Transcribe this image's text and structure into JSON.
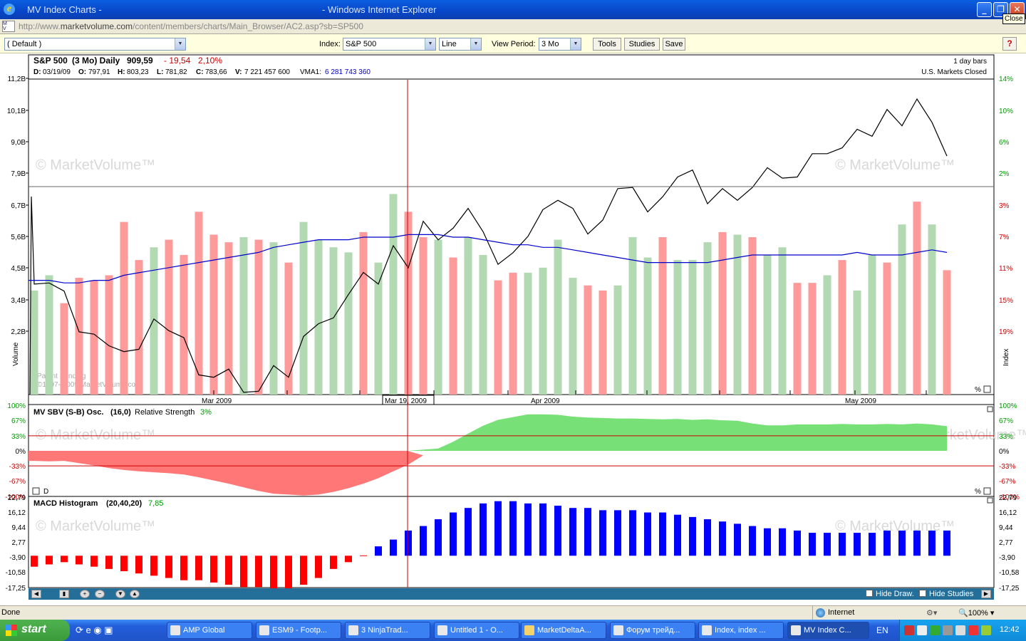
{
  "window": {
    "title_left": "MV Index Charts -",
    "title_right": "- Windows Internet Explorer",
    "tooltip": "Close"
  },
  "address": {
    "url_gray": "http://www.",
    "url_dark": "marketvolume.com",
    "url_rest": "/content/members/charts/Main_Browser/AC2.asp?sb=SP500"
  },
  "toolbar": {
    "template": "( Default )",
    "index_label": "Index:",
    "index_value": "S&P 500",
    "chart_type": "Line",
    "period_label": "View Period:",
    "period_value": "3 Mo",
    "tools": "Tools",
    "studies": "Studies",
    "save": "Save",
    "help": "?"
  },
  "header": {
    "name": "S&P 500",
    "period": "(3 Mo) Daily",
    "last": "909,59",
    "change": "- 19,54",
    "pct": "2,10%",
    "d_lbl": "D:",
    "d": "03/19/09",
    "o_lbl": "O:",
    "o": "797,91",
    "h_lbl": "H:",
    "h": "803,23",
    "l_lbl": "L:",
    "l": "781,82",
    "c_lbl": "C:",
    "c": "783,66",
    "v_lbl": "V:",
    "v": "7 221 457 600",
    "vma_lbl": "VMA1:",
    "vma": "6 281 743 360",
    "bars": "1 day bars",
    "market": "U.S. Markets Closed"
  },
  "panels": {
    "watermark": "© MarketVolume™",
    "patent": "Patent Pending",
    "copyright": "©1997- 2009 MarketVolume.com",
    "volume_axis": "Volume",
    "index_axis": "Index",
    "pct": "%",
    "osc_title": "MV SBV (S-B) Osc.",
    "osc_params": "(16,0)",
    "osc_rs_lbl": "Relative Strength",
    "osc_rs": "3%",
    "osc_d": "D",
    "macd_title": "MACD Histogram",
    "macd_params": "(20,40,20)",
    "macd_value": "7,85"
  },
  "dates": {
    "mar": "Mar 2009",
    "cursor": "Mar 19, 2009",
    "apr": "Apr 2009",
    "may": "May 2009"
  },
  "colors": {
    "up": "#b3d9b3",
    "down": "#ff9a9a",
    "price": "#000000",
    "vma": "#0000cc",
    "osc_pos": "#77e077",
    "osc_neg": "#ff7777",
    "macd_pos": "#0000ff",
    "macd_neg": "#ff0000",
    "cursor": "#cc0000"
  },
  "chart_data": [
    {
      "type": "bar",
      "name": "volume",
      "ylabel": "Volume",
      "ylim": [
        0,
        12.4
      ],
      "yticks": [
        "11,2B",
        "10,1B",
        "9,0B",
        "7,9B",
        "6,7B",
        "5,6B",
        "4,5B",
        "3,4B",
        "2,2B"
      ],
      "values": [
        4.1,
        4.7,
        3.6,
        4.6,
        4.5,
        4.7,
        6.8,
        5.3,
        5.8,
        6.1,
        5.5,
        7.2,
        6.3,
        6.0,
        6.2,
        6.1,
        6.0,
        5.2,
        6.8,
        6.1,
        5.8,
        5.6,
        6.4,
        5.2,
        7.9,
        7.2,
        6.2,
        6.1,
        5.4,
        6.2,
        5.5,
        4.5,
        4.8,
        4.8,
        5.0,
        6.1,
        4.6,
        4.3,
        4.1,
        4.3,
        6.2,
        5.4,
        6.2,
        5.3,
        5.3,
        6.0,
        6.4,
        6.3,
        6.2,
        5.5,
        5.8,
        4.4,
        4.4,
        4.7,
        5.3,
        4.1,
        5.5,
        5.2,
        6.7,
        7.6,
        6.7,
        4.9
      ],
      "direction": [
        "u",
        "u",
        "d",
        "d",
        "d",
        "d",
        "d",
        "d",
        "u",
        "d",
        "d",
        "d",
        "d",
        "d",
        "u",
        "d",
        "u",
        "d",
        "u",
        "u",
        "u",
        "u",
        "d",
        "u",
        "u",
        "d",
        "d",
        "u",
        "d",
        "u",
        "u",
        "d",
        "d",
        "u",
        "u",
        "u",
        "u",
        "d",
        "d",
        "u",
        "u",
        "u",
        "d",
        "u",
        "u",
        "u",
        "d",
        "u",
        "d",
        "u",
        "u",
        "d",
        "d",
        "u",
        "d",
        "u",
        "u",
        "d",
        "u",
        "d",
        "u",
        "d"
      ],
      "vma": [
        4.5,
        4.5,
        4.4,
        4.4,
        4.5,
        4.5,
        4.7,
        4.8,
        4.9,
        5.0,
        5.1,
        5.2,
        5.3,
        5.4,
        5.5,
        5.6,
        5.8,
        5.9,
        6.0,
        6.1,
        6.1,
        6.1,
        6.2,
        6.2,
        6.2,
        6.3,
        6.3,
        6.3,
        6.2,
        6.2,
        6.1,
        6.0,
        5.9,
        5.9,
        5.8,
        5.8,
        5.7,
        5.6,
        5.5,
        5.4,
        5.3,
        5.2,
        5.2,
        5.2,
        5.2,
        5.2,
        5.3,
        5.4,
        5.5,
        5.5,
        5.5,
        5.5,
        5.5,
        5.5,
        5.5,
        5.6,
        5.5,
        5.5,
        5.5,
        5.6,
        5.7,
        5.6
      ],
      "price_axis": [
        "14%",
        "10%",
        "6%",
        "2%",
        "3%",
        "7%",
        "11%",
        "15%",
        "19%"
      ],
      "price": [
        770,
        771,
        764,
        729,
        727,
        717,
        712,
        714,
        740,
        730,
        724,
        692,
        690,
        697,
        677,
        678,
        700,
        690,
        725,
        736,
        741,
        761,
        780,
        770,
        803,
        784,
        824,
        808,
        818,
        835,
        815,
        787,
        797,
        811,
        834,
        842,
        835,
        813,
        825,
        852,
        853,
        832,
        845,
        862,
        868,
        839,
        852,
        842,
        853,
        870,
        861,
        862,
        882,
        882,
        887,
        903,
        897,
        920,
        906,
        929,
        909,
        880
      ]
    },
    {
      "type": "area",
      "name": "MV SBV (S-B) Osc.",
      "ylim": [
        -100,
        100
      ],
      "yticks": [
        "100%",
        "67%",
        "33%",
        "0%",
        "-33%",
        "-67%",
        "-100%"
      ],
      "values": [
        -22,
        -23,
        -22,
        -27,
        -32,
        -38,
        -42,
        -45,
        -47,
        -49,
        -52,
        -58,
        -65,
        -72,
        -80,
        -88,
        -94,
        -96,
        -98,
        -96,
        -90,
        -82,
        -72,
        -60,
        -45,
        -30,
        -10,
        5,
        20,
        38,
        55,
        68,
        74,
        80,
        80,
        79,
        75,
        73,
        72,
        71,
        71,
        70,
        69,
        70,
        68,
        69,
        67,
        66,
        60,
        56,
        56,
        58,
        58,
        58,
        59,
        58,
        58,
        59,
        58,
        60,
        58,
        54
      ]
    },
    {
      "type": "bar",
      "name": "MACD Histogram",
      "ylim": [
        -17.25,
        22.79
      ],
      "yticks": [
        "22,79",
        "16,12",
        "9,44",
        "2,77",
        "-3,90",
        "-10,58",
        "-17,25"
      ],
      "values": [
        -8,
        -7,
        -6,
        -7,
        -8,
        -9,
        -10,
        -11,
        -12,
        -13,
        -14,
        -14,
        -15,
        -16,
        -17,
        -17,
        -18,
        -18,
        -16,
        -13,
        -9,
        -6,
        -3,
        1,
        4,
        8,
        10,
        13,
        16,
        18,
        20,
        21,
        21,
        20,
        20,
        19,
        18,
        18,
        17,
        17,
        17,
        16,
        16,
        15,
        14,
        13,
        12,
        11,
        10,
        9,
        9,
        8,
        7,
        7,
        7,
        7,
        7,
        8,
        8,
        8,
        8,
        8
      ]
    }
  ],
  "statusbar": {
    "done": "Done",
    "zone": "Internet",
    "zoom": "100%"
  },
  "taskbar": {
    "start": "start",
    "items": [
      "AMP Global",
      "ESM9 - Footp...",
      "3 NinjaTrad...",
      "Untitled 1 - O...",
      "MarketDeltaA...",
      "Форум трейд...",
      "Index, index ...",
      "MV Index C..."
    ],
    "lang": "EN",
    "time": "12:42"
  },
  "scroll": {
    "hide_draw": "Hide Draw.",
    "hide_studies": "Hide Studies"
  }
}
